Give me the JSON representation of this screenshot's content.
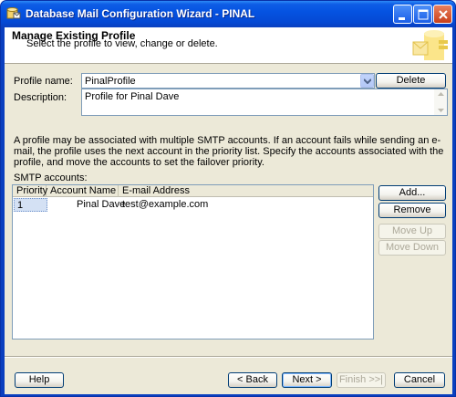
{
  "window": {
    "title": "Database Mail Configuration Wizard - PINAL"
  },
  "header": {
    "title": "Manage Existing Profile",
    "subtitle": "Select the profile to view, change or delete."
  },
  "profile": {
    "name_label": "Profile name:",
    "name_value": "PinalProfile",
    "delete_label": "Delete",
    "description_label": "Description:",
    "description_value": "Profile for Pinal Dave"
  },
  "info_text": "A profile may be associated with multiple SMTP accounts. If an account fails while sending an e-mail, the profile uses the next account in the priority list. Specify the accounts associated with the profile, and move the accounts to set the failover priority.",
  "smtp": {
    "label": "SMTP accounts:",
    "columns": [
      "Priority",
      "Account Name",
      "E-mail Address"
    ],
    "rows": [
      {
        "priority": "1",
        "account": "Pinal Dave",
        "email": "test@example.com"
      }
    ],
    "buttons": {
      "add": "Add...",
      "remove": "Remove",
      "move_up": "Move Up",
      "move_down": "Move Down"
    }
  },
  "footer": {
    "help": "Help",
    "back": "< Back",
    "next": "Next >",
    "finish": "Finish >>|",
    "cancel": "Cancel"
  },
  "colors": {
    "titlebar": "#0553e1",
    "dialog_bg": "#ece9d8",
    "selection": "#d4e1f4"
  }
}
